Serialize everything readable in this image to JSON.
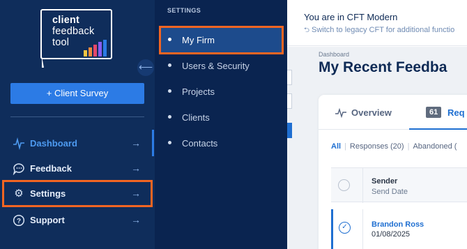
{
  "banner": {
    "title": "You are in CFT Modern",
    "link": "Switch to legacy CFT for additional functio"
  },
  "main": {
    "breadcrumb": "Dashboard",
    "title": "My Recent Feedba",
    "tabs": {
      "overview": "Overview",
      "requests_count": "61",
      "requests_label": "Req"
    },
    "filters": {
      "all": "All",
      "separator": "|",
      "responses": "Responses (20)",
      "abandoned": "Abandoned ("
    },
    "table": {
      "header_sender": "Sender",
      "header_date": "Send Date",
      "rows": [
        {
          "name": "Brandon Ross",
          "date": "01/08/2025"
        }
      ]
    }
  },
  "sidebar": {
    "logo": {
      "line1": "client",
      "line2": "feedback",
      "line3": "tool"
    },
    "survey_button": "+ Client Survey",
    "items": [
      {
        "label": "Dashboard",
        "icon": "pulse-icon",
        "active": true
      },
      {
        "label": "Feedback",
        "icon": "chat-icon",
        "active": false
      },
      {
        "label": "Settings",
        "icon": "gear-icon",
        "active": false
      },
      {
        "label": "Support",
        "icon": "help-icon",
        "active": false
      }
    ]
  },
  "submenu": {
    "title": "SETTINGS",
    "items": [
      {
        "label": "My Firm",
        "active": true
      },
      {
        "label": "Users & Security",
        "active": false
      },
      {
        "label": "Projects",
        "active": false
      },
      {
        "label": "Clients",
        "active": false
      },
      {
        "label": "Contacts",
        "active": false
      }
    ]
  },
  "colors": {
    "sidebar_bg": "#0f2d5b",
    "submenu_bg": "#0a2450",
    "accent": "#2c7be5",
    "highlight": "#f26522",
    "title": "#0e2a55"
  },
  "logo_bars": [
    "#f5c542",
    "#f08a3c",
    "#e5486a",
    "#8a5cf0",
    "#2c7be5"
  ]
}
